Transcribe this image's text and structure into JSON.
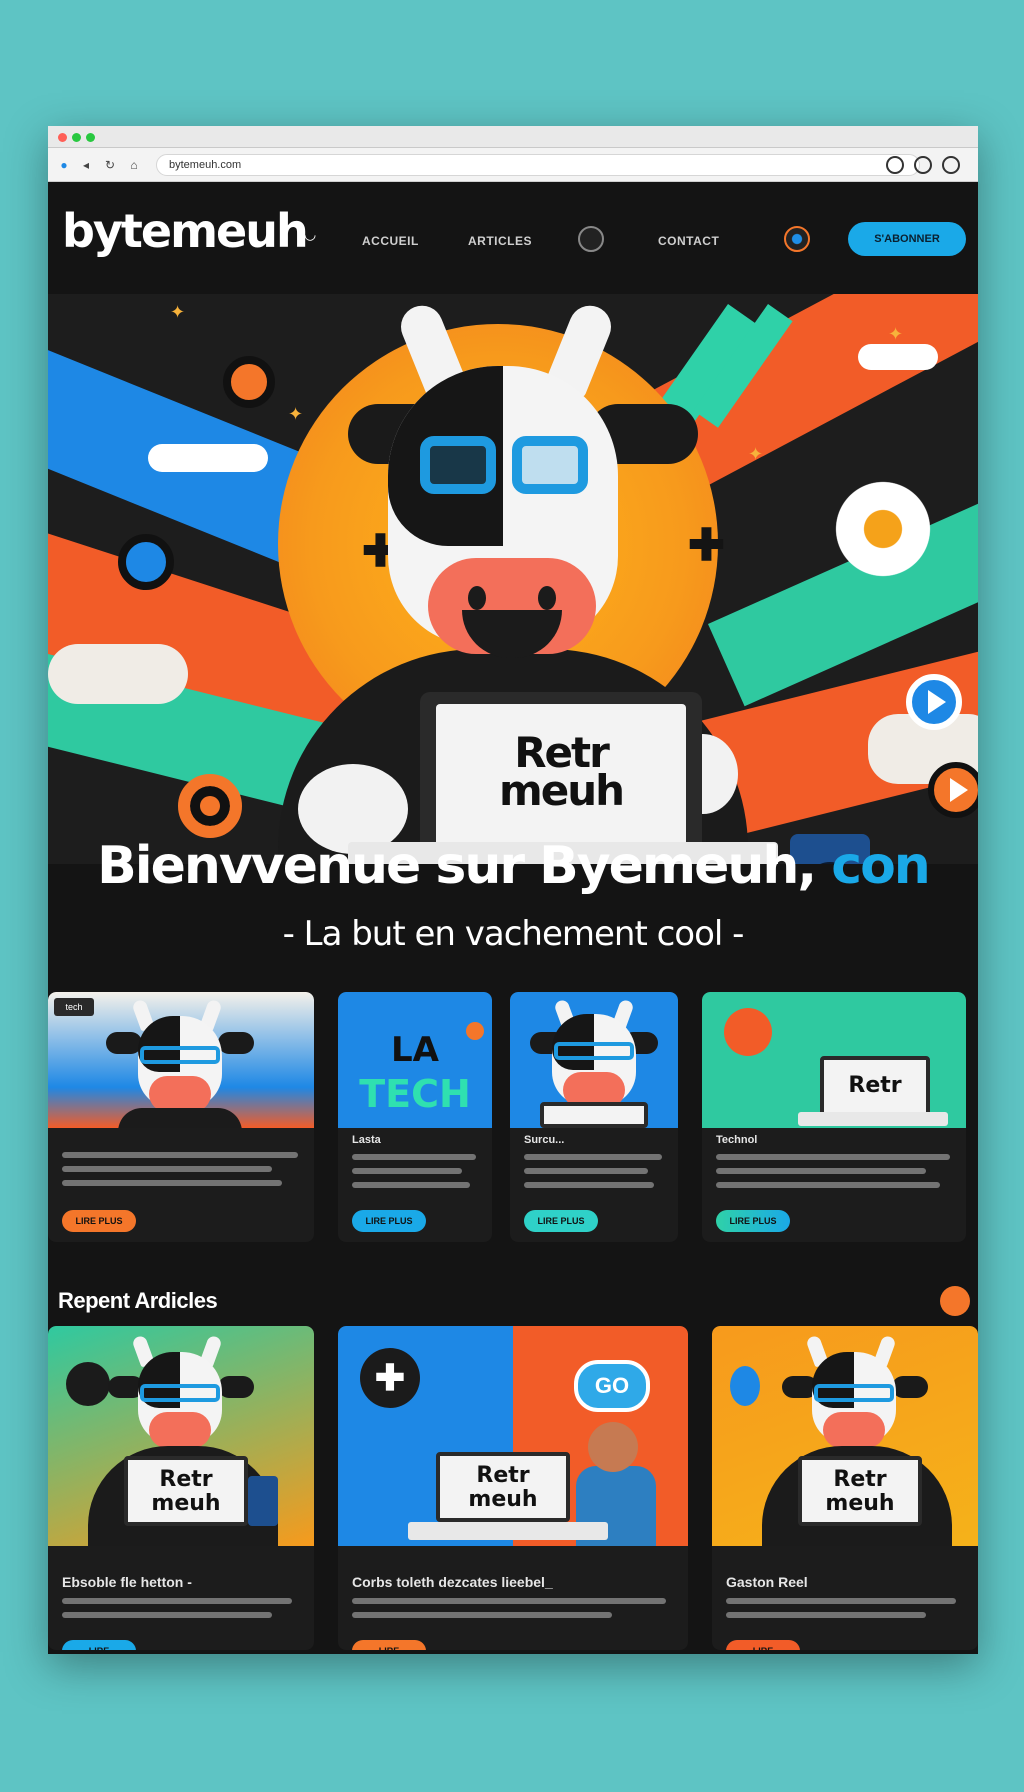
{
  "browser": {
    "url": "bytemeuh.com"
  },
  "header": {
    "logo": "bytemeuh",
    "nav": [
      "ACCUEIL",
      "ARTICLES",
      "CONTACT"
    ],
    "cta": "S'ABONNER"
  },
  "hero": {
    "laptop_text_line1": "Retr",
    "laptop_text_line2": "meuh"
  },
  "welcome": {
    "title_main": "Bienvvenue sur Byemeuh,",
    "title_accent": "con",
    "subtitle": "- La but en vachement cool -"
  },
  "top_cards": [
    {
      "tag": "tech",
      "title": "",
      "button": "LIRE PLUS"
    },
    {
      "image_title_1": "LA",
      "image_title_2": "TECH",
      "title": "Lasta",
      "button": "LIRE PLUS"
    },
    {
      "title": "Surcu...",
      "button": "LIRE PLUS"
    },
    {
      "laptop_text": "Retr",
      "title": "Technol",
      "button": "LIRE PLUS"
    }
  ],
  "recent": {
    "section_title": "Repent Ardicles",
    "cards": [
      {
        "laptop_text_1": "Retr",
        "laptop_text_2": "meuh",
        "title": "Ebsoble fle hetton -",
        "button": "LIRE"
      },
      {
        "laptop_text_1": "Retr",
        "laptop_text_2": "meuh",
        "badge": "GO",
        "title": "Corbs toleth dezcates lieebel_",
        "button": "LIRE"
      },
      {
        "laptop_text_1": "Retr",
        "laptop_text_2": "meuh",
        "title": "Gaston Reel",
        "button": "LIRE"
      }
    ]
  },
  "colors": {
    "accent_blue": "#1aa9e8",
    "accent_orange": "#f4762a",
    "accent_teal": "#2fd1a8",
    "background": "#141414"
  }
}
